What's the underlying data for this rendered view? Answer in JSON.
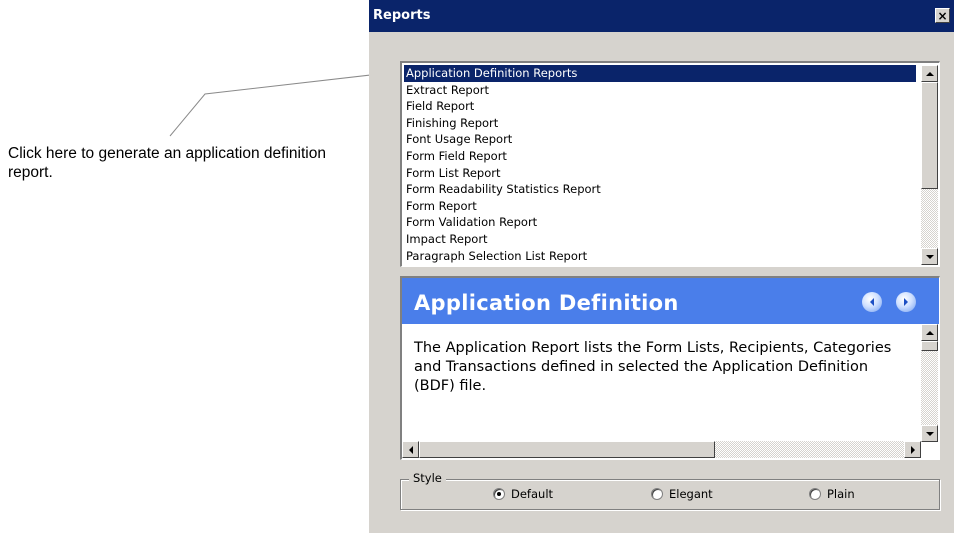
{
  "callout": {
    "text": "Click here to generate an application definition report."
  },
  "window": {
    "title": "Reports",
    "close_label": "×"
  },
  "report_list": {
    "items": [
      "Application Definition Reports",
      "Extract Report",
      "Field Report",
      "Finishing Report",
      "Font Usage Report",
      "Form Field Report",
      "Form List Report",
      "Form Readability Statistics Report",
      "Form Report",
      "Form Validation Report",
      "Impact Report",
      "Paragraph Selection List Report"
    ],
    "selected_index": 0
  },
  "description": {
    "title": "Application Definition",
    "body": "The Application Report lists the Form Lists, Recipients, Categories and Transactions defined in selected the Application Definition (BDF) file."
  },
  "style_group": {
    "label": "Style",
    "options": [
      "Default",
      "Elegant",
      "Plain"
    ],
    "selected": "Default"
  },
  "colors": {
    "titlebar": "#0a246a",
    "dialog_bg": "#d6d3ce",
    "selection": "#0a246a",
    "header_blue": "#4a7eea"
  },
  "icons": {
    "close": "close-icon",
    "back": "back-arrow-icon",
    "forward": "forward-arrow-icon",
    "scroll_up": "scroll-up-icon",
    "scroll_down": "scroll-down-icon",
    "scroll_left": "scroll-left-icon",
    "scroll_right": "scroll-right-icon"
  }
}
